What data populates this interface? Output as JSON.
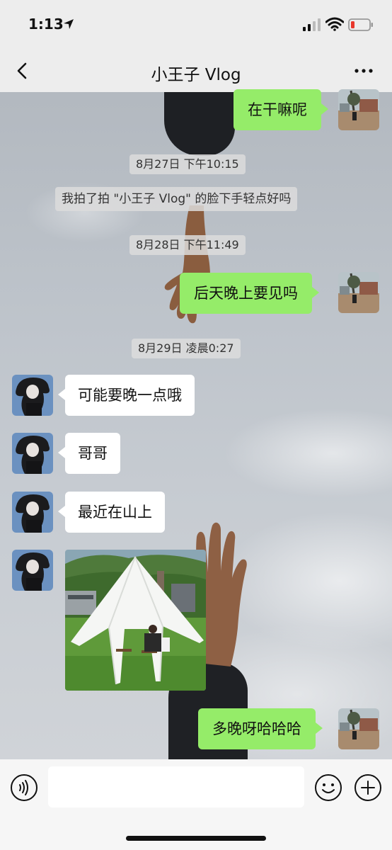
{
  "status_bar": {
    "time": "1:13"
  },
  "nav": {
    "title": "小王子 Vlog",
    "back_icon": "chevron-left-icon",
    "more_icon": "more-dots-icon"
  },
  "messages": [
    {
      "type": "outgoing",
      "text": "在干嘛呢"
    },
    {
      "type": "timestamp",
      "text": "8月27日 下午10:15"
    },
    {
      "type": "system",
      "text": "我拍了拍 \"小王子 Vlog\" 的脸下手轻点好吗"
    },
    {
      "type": "timestamp",
      "text": "8月28日 下午11:49"
    },
    {
      "type": "outgoing",
      "text": "后天晚上要见吗"
    },
    {
      "type": "timestamp",
      "text": "8月29日 凌晨0:27"
    },
    {
      "type": "incoming",
      "text": "可能要晚一点哦"
    },
    {
      "type": "incoming",
      "text": "哥哥"
    },
    {
      "type": "incoming",
      "text": "最近在山上"
    },
    {
      "type": "incoming-image"
    },
    {
      "type": "outgoing",
      "text": "多晚呀哈哈哈"
    }
  ],
  "input_bar": {
    "message_value": "",
    "voice_icon": "voice-icon",
    "emoji_icon": "emoji-icon",
    "plus_icon": "plus-icon"
  },
  "colors": {
    "outgoing_bubble": "#95ec69",
    "incoming_bubble": "#ffffff",
    "bar_background": "#ededed"
  }
}
